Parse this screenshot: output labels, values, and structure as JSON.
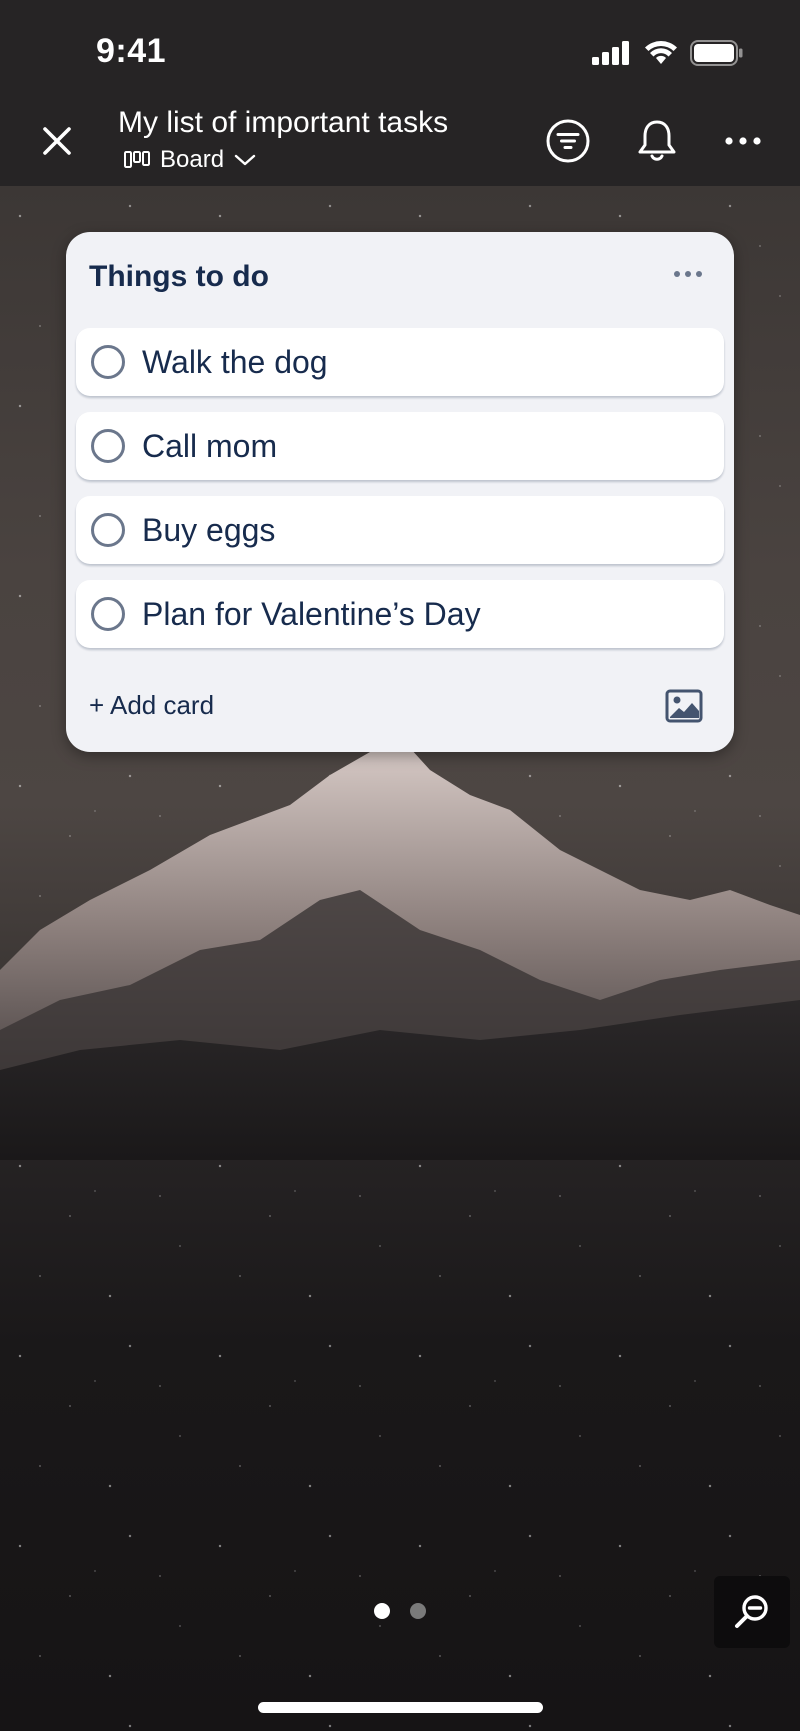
{
  "status_bar": {
    "time": "9:41",
    "icons": [
      "cellular-signal-icon",
      "wifi-icon",
      "battery-icon"
    ]
  },
  "header": {
    "title": "My list of important tasks",
    "view_label": "Board",
    "icons": {
      "close": "close-icon",
      "view": "board-view-icon",
      "view_dropdown": "chevron-down-icon",
      "filter": "filter-icon",
      "notifications": "bell-icon",
      "more": "more-icon"
    }
  },
  "list": {
    "title": "Things to do",
    "cards": [
      {
        "label": "Walk the dog",
        "completed": false
      },
      {
        "label": "Call mom",
        "completed": false
      },
      {
        "label": "Buy eggs",
        "completed": false
      },
      {
        "label": "Plan for Valentine’s Day",
        "completed": false
      }
    ],
    "add_card_label": "+ Add card",
    "template_icon": "image-icon"
  },
  "pager": {
    "pages": 2,
    "current_page": 1
  },
  "zoom_icon": "zoom-out-icon",
  "colors": {
    "header_bg": "#262425",
    "list_bg": "#f1f2f6",
    "card_text": "#172b4d",
    "checkbox_border": "#6b778c"
  }
}
